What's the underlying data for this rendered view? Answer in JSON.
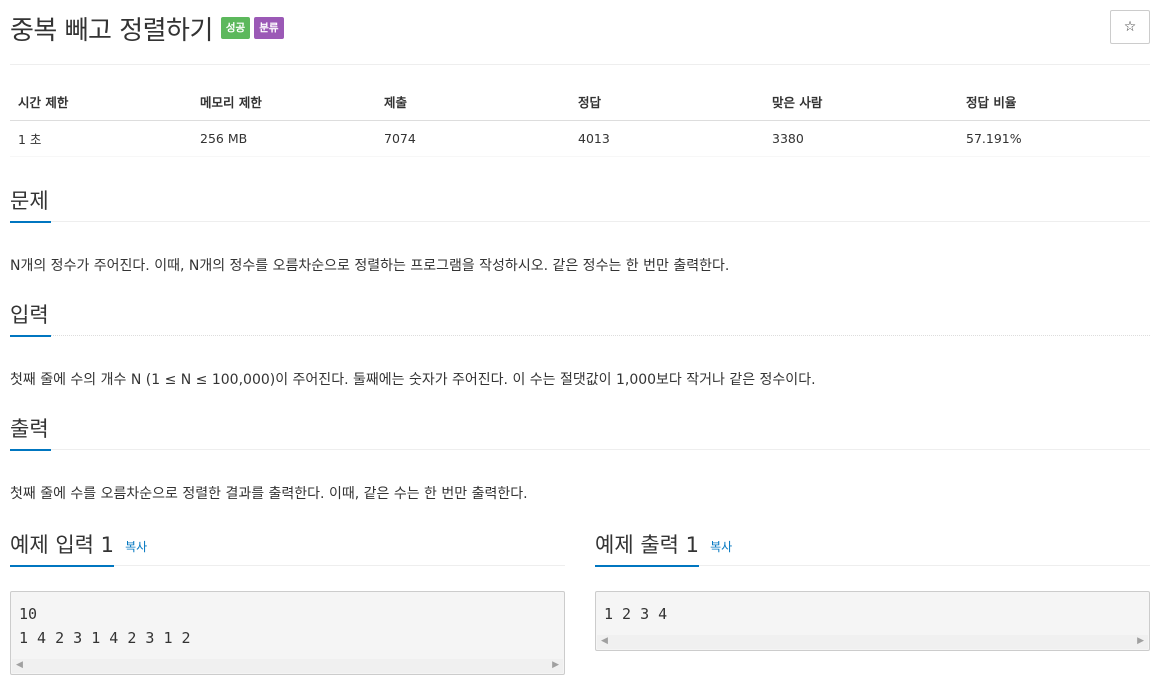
{
  "problem": {
    "title": "중복 빼고 정렬하기",
    "badges": {
      "success": "성공",
      "category": "분류"
    },
    "star_icon": "☆"
  },
  "info_table": {
    "headers": [
      "시간 제한",
      "메모리 제한",
      "제출",
      "정답",
      "맞은 사람",
      "정답 비율"
    ],
    "values": [
      "1 초",
      "256 MB",
      "7074",
      "4013",
      "3380",
      "57.191%"
    ]
  },
  "sections": {
    "problem": {
      "heading": "문제",
      "text": "N개의 정수가 주어진다. 이때, N개의 정수를 오름차순으로 정렬하는 프로그램을 작성하시오. 같은 정수는 한 번만 출력한다."
    },
    "input": {
      "heading": "입력",
      "text": "첫째 줄에 수의 개수 N (1 ≤ N ≤ 100,000)이 주어진다. 둘째에는 숫자가 주어진다. 이 수는 절댓값이 1,000보다 작거나 같은 정수이다."
    },
    "output": {
      "heading": "출력",
      "text": "첫째 줄에 수를 오름차순으로 정렬한 결과를 출력한다. 이때, 같은 수는 한 번만 출력한다."
    }
  },
  "samples": {
    "input": {
      "heading": "예제 입력 1",
      "copy_label": "복사",
      "content": "10\n1 4 2 3 1 4 2 3 1 2"
    },
    "output": {
      "heading": "예제 출력 1",
      "copy_label": "복사",
      "content": "1 2 3 4"
    }
  },
  "colors": {
    "accent": "#0076c0",
    "success": "#5cb85c",
    "category": "#9b59b6"
  }
}
